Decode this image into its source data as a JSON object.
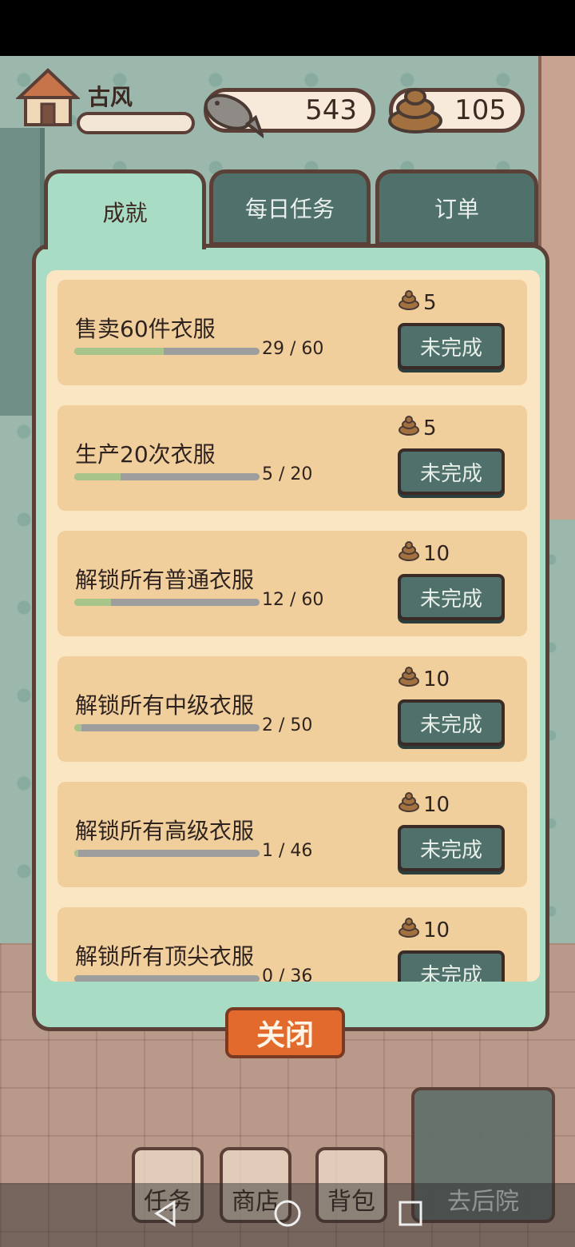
{
  "hud": {
    "player_name": "古风",
    "fish_count": "543",
    "poop_count": "105"
  },
  "tabs": [
    {
      "label": "成就",
      "active": true
    },
    {
      "label": "每日任务",
      "active": false
    },
    {
      "label": "订单",
      "active": false
    }
  ],
  "achievements": [
    {
      "title": "售卖60件衣服",
      "progress_text": "29 / 60",
      "current": 29,
      "total": 60,
      "reward": "5",
      "status": "未完成"
    },
    {
      "title": "生产20次衣服",
      "progress_text": "5 / 20",
      "current": 5,
      "total": 20,
      "reward": "5",
      "status": "未完成"
    },
    {
      "title": "解锁所有普通衣服",
      "progress_text": "12 / 60",
      "current": 12,
      "total": 60,
      "reward": "10",
      "status": "未完成"
    },
    {
      "title": "解锁所有中级衣服",
      "progress_text": "2 / 50",
      "current": 2,
      "total": 50,
      "reward": "10",
      "status": "未完成"
    },
    {
      "title": "解锁所有高级衣服",
      "progress_text": "1 / 46",
      "current": 1,
      "total": 46,
      "reward": "10",
      "status": "未完成"
    },
    {
      "title": "解锁所有顶尖衣服",
      "progress_text": "0 / 36",
      "current": 0,
      "total": 36,
      "reward": "10",
      "status": "未完成"
    }
  ],
  "close_label": "关闭",
  "bottom_menu": {
    "task": "任务",
    "shop": "商店",
    "bag": "背包",
    "backyard": "去后院"
  },
  "colors": {
    "panel": "#a9dcc5",
    "card": "#f0cf9c",
    "button": "#4f706b",
    "close": "#e26a2c",
    "progress_fill": "#a7c48a"
  },
  "icons": [
    "house-icon",
    "fish-icon",
    "poop-icon",
    "back-icon",
    "home-nav-icon",
    "recents-icon"
  ]
}
